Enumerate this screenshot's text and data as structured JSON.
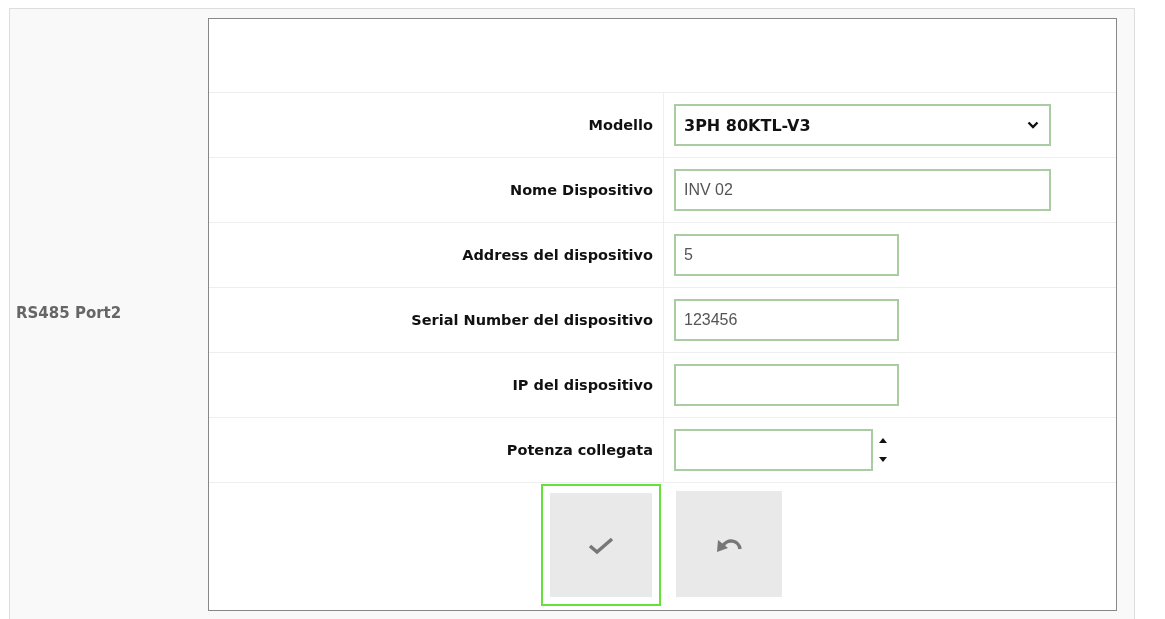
{
  "section_label": "RS485 Port2",
  "fields": [
    {
      "kind": "select",
      "label": "Modello",
      "value": "3PH 80KTL-V3"
    },
    {
      "kind": "text",
      "label": "Nome Dispositivo",
      "value": "INV 02"
    },
    {
      "kind": "text_short",
      "label": "Address del dispositivo",
      "value": "5"
    },
    {
      "kind": "text_short",
      "label": "Serial Number del dispositivo",
      "value": "123456"
    },
    {
      "kind": "text_short",
      "label": "IP del dispositivo"
    },
    {
      "kind": "number",
      "label": "Potenza collegata"
    }
  ],
  "buttons": [
    {
      "kind": "confirm",
      "focused": true
    },
    {
      "kind": "undo",
      "focused": false
    }
  ]
}
